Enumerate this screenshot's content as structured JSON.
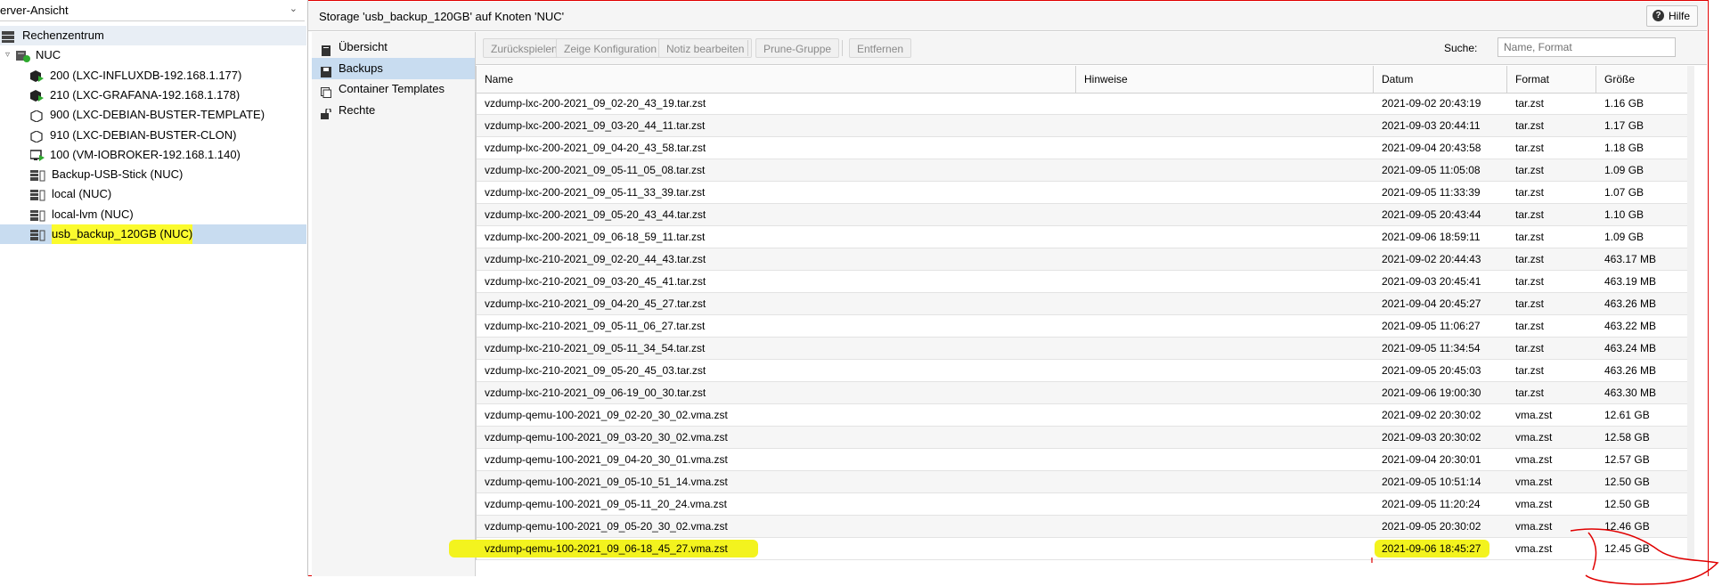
{
  "left_panel": {
    "view_select": "erver-Ansicht",
    "tree": [
      {
        "label": "Rechenzentrum",
        "icon": "datacenter-icon",
        "type": "root"
      },
      {
        "label": "NUC",
        "icon": "node-icon",
        "type": "node",
        "expander": "▿"
      },
      {
        "label": "200 (LXC-INFLUXDB-192.168.1.177)",
        "icon": "container-running-icon",
        "type": "guest"
      },
      {
        "label": "210 (LXC-GRAFANA-192.168.1.178)",
        "icon": "container-running-icon",
        "type": "guest"
      },
      {
        "label": "900 (LXC-DEBIAN-BUSTER-TEMPLATE)",
        "icon": "container-template-icon",
        "type": "guest"
      },
      {
        "label": "910 (LXC-DEBIAN-BUSTER-CLON)",
        "icon": "container-stopped-icon",
        "type": "guest"
      },
      {
        "label": "100 (VM-IOBROKER-192.168.1.140)",
        "icon": "vm-running-icon",
        "type": "guest"
      },
      {
        "label": "Backup-USB-Stick (NUC)",
        "icon": "storage-icon",
        "type": "storage"
      },
      {
        "label": "local (NUC)",
        "icon": "storage-icon",
        "type": "storage"
      },
      {
        "label": "local-lvm (NUC)",
        "icon": "storage-icon",
        "type": "storage"
      },
      {
        "label": "usb_backup_120GB (NUC)",
        "icon": "storage-icon",
        "type": "storage",
        "selected": true
      }
    ]
  },
  "header": {
    "title": "Storage 'usb_backup_120GB' auf Knoten 'NUC'",
    "help_label": "Hilfe"
  },
  "subnav": [
    {
      "label": "Übersicht",
      "icon": "book-icon"
    },
    {
      "label": "Backups",
      "icon": "save-icon",
      "selected": true
    },
    {
      "label": "Container Templates",
      "icon": "template-icon"
    },
    {
      "label": "Rechte",
      "icon": "unlock-icon"
    }
  ],
  "toolbar": {
    "restore": "Zurückspielen",
    "show_config": "Zeige Konfiguration",
    "edit_notes": "Notiz bearbeiten",
    "prune_group": "Prune-Gruppe",
    "remove": "Entfernen",
    "search_label": "Suche:",
    "search_placeholder": "Name, Format"
  },
  "grid": {
    "columns": [
      "Name",
      "Hinweise",
      "Datum",
      "Format",
      "Größe"
    ],
    "rows": [
      {
        "name": "vzdump-lxc-200-2021_09_02-20_43_19.tar.zst",
        "notes": "",
        "date": "2021-09-02 20:43:19",
        "format": "tar.zst",
        "size": "1.16 GB"
      },
      {
        "name": "vzdump-lxc-200-2021_09_03-20_44_11.tar.zst",
        "notes": "",
        "date": "2021-09-03 20:44:11",
        "format": "tar.zst",
        "size": "1.17 GB"
      },
      {
        "name": "vzdump-lxc-200-2021_09_04-20_43_58.tar.zst",
        "notes": "",
        "date": "2021-09-04 20:43:58",
        "format": "tar.zst",
        "size": "1.18 GB"
      },
      {
        "name": "vzdump-lxc-200-2021_09_05-11_05_08.tar.zst",
        "notes": "",
        "date": "2021-09-05 11:05:08",
        "format": "tar.zst",
        "size": "1.09 GB"
      },
      {
        "name": "vzdump-lxc-200-2021_09_05-11_33_39.tar.zst",
        "notes": "",
        "date": "2021-09-05 11:33:39",
        "format": "tar.zst",
        "size": "1.07 GB"
      },
      {
        "name": "vzdump-lxc-200-2021_09_05-20_43_44.tar.zst",
        "notes": "",
        "date": "2021-09-05 20:43:44",
        "format": "tar.zst",
        "size": "1.10 GB"
      },
      {
        "name": "vzdump-lxc-200-2021_09_06-18_59_11.tar.zst",
        "notes": "",
        "date": "2021-09-06 18:59:11",
        "format": "tar.zst",
        "size": "1.09 GB"
      },
      {
        "name": "vzdump-lxc-210-2021_09_02-20_44_43.tar.zst",
        "notes": "",
        "date": "2021-09-02 20:44:43",
        "format": "tar.zst",
        "size": "463.17 MB"
      },
      {
        "name": "vzdump-lxc-210-2021_09_03-20_45_41.tar.zst",
        "notes": "",
        "date": "2021-09-03 20:45:41",
        "format": "tar.zst",
        "size": "463.19 MB"
      },
      {
        "name": "vzdump-lxc-210-2021_09_04-20_45_27.tar.zst",
        "notes": "",
        "date": "2021-09-04 20:45:27",
        "format": "tar.zst",
        "size": "463.26 MB"
      },
      {
        "name": "vzdump-lxc-210-2021_09_05-11_06_27.tar.zst",
        "notes": "",
        "date": "2021-09-05 11:06:27",
        "format": "tar.zst",
        "size": "463.22 MB"
      },
      {
        "name": "vzdump-lxc-210-2021_09_05-11_34_54.tar.zst",
        "notes": "",
        "date": "2021-09-05 11:34:54",
        "format": "tar.zst",
        "size": "463.24 MB"
      },
      {
        "name": "vzdump-lxc-210-2021_09_05-20_45_03.tar.zst",
        "notes": "",
        "date": "2021-09-05 20:45:03",
        "format": "tar.zst",
        "size": "463.26 MB"
      },
      {
        "name": "vzdump-lxc-210-2021_09_06-19_00_30.tar.zst",
        "notes": "",
        "date": "2021-09-06 19:00:30",
        "format": "tar.zst",
        "size": "463.30 MB"
      },
      {
        "name": "vzdump-qemu-100-2021_09_02-20_30_02.vma.zst",
        "notes": "",
        "date": "2021-09-02 20:30:02",
        "format": "vma.zst",
        "size": "12.61 GB"
      },
      {
        "name": "vzdump-qemu-100-2021_09_03-20_30_02.vma.zst",
        "notes": "",
        "date": "2021-09-03 20:30:02",
        "format": "vma.zst",
        "size": "12.58 GB"
      },
      {
        "name": "vzdump-qemu-100-2021_09_04-20_30_01.vma.zst",
        "notes": "",
        "date": "2021-09-04 20:30:01",
        "format": "vma.zst",
        "size": "12.57 GB"
      },
      {
        "name": "vzdump-qemu-100-2021_09_05-10_51_14.vma.zst",
        "notes": "",
        "date": "2021-09-05 10:51:14",
        "format": "vma.zst",
        "size": "12.50 GB"
      },
      {
        "name": "vzdump-qemu-100-2021_09_05-11_20_24.vma.zst",
        "notes": "",
        "date": "2021-09-05 11:20:24",
        "format": "vma.zst",
        "size": "12.50 GB"
      },
      {
        "name": "vzdump-qemu-100-2021_09_05-20_30_02.vma.zst",
        "notes": "",
        "date": "2021-09-05 20:30:02",
        "format": "vma.zst",
        "size": "12.46 GB"
      },
      {
        "name": "vzdump-qemu-100-2021_09_06-18_45_27.vma.zst",
        "notes": "",
        "date": "2021-09-06 18:45:27",
        "format": "vma.zst",
        "size": "12.45 GB",
        "highlighted": true
      }
    ]
  },
  "colors": {
    "selection": "#c8dcf0",
    "highlighter": "#f3f31e",
    "annotation": "#e00000",
    "running": "#2eaa2e"
  }
}
